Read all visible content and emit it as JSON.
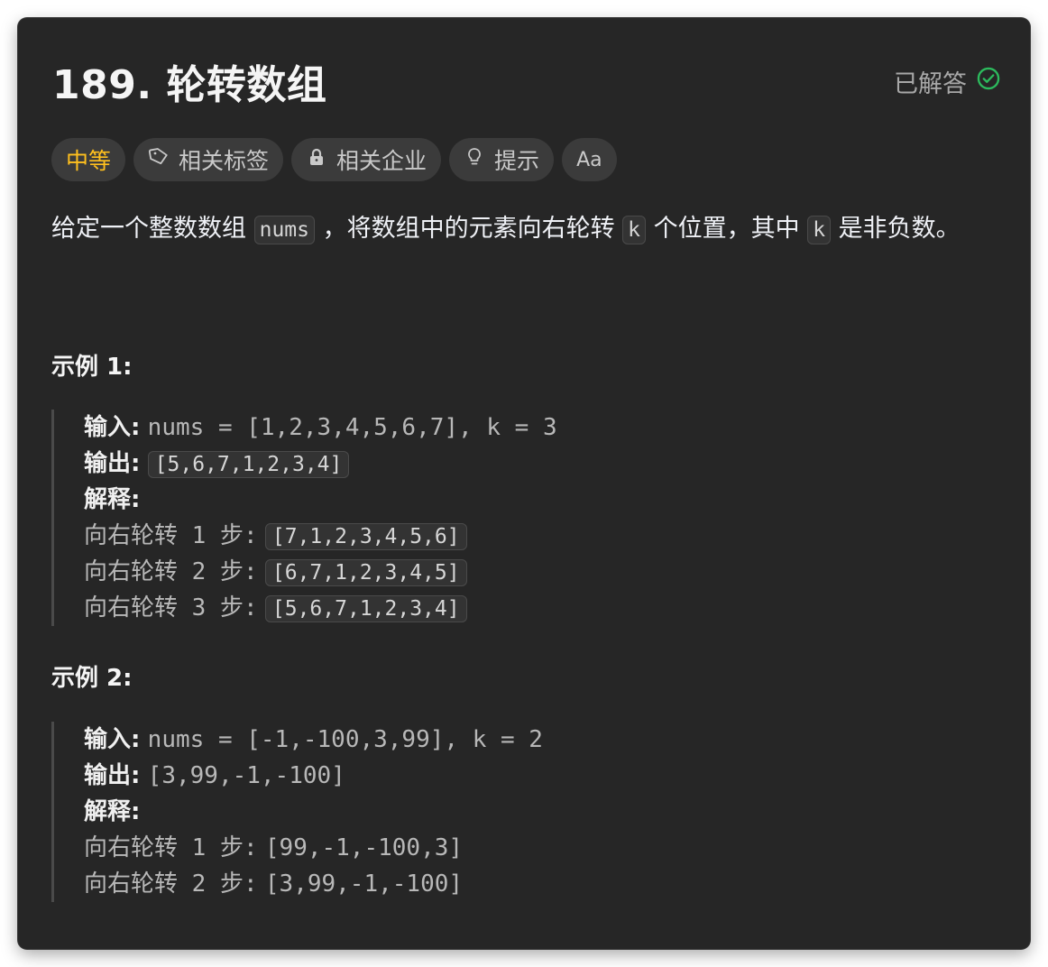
{
  "problem": {
    "title": "189. 轮转数组",
    "status_label": "已解答",
    "tags": [
      "中等",
      "相关标签",
      "相关企业",
      "提示",
      "Aa"
    ]
  },
  "description": {
    "part1": "给定一个整数数组",
    "code1": "nums",
    "part2": "，将数组中的元素向右轮转",
    "code2": "k",
    "part3": "个位置，其中",
    "code3": "k",
    "part4": "是非负数。"
  },
  "examples": [
    {
      "title": "示例 1:",
      "input_label": "输入:",
      "input": "nums = [1,2,3,4,5,6,7], k = 3",
      "output_label": "输出:",
      "output": "[5,6,7,1,2,3,4]",
      "explain_label": "解释:",
      "steps": [
        {
          "text": "向右轮转 1 步:",
          "value": "[7,1,2,3,4,5,6]"
        },
        {
          "text": "向右轮转 2 步:",
          "value": "[6,7,1,2,3,4,5]"
        },
        {
          "text": "向右轮转 3 步:",
          "value": "[5,6,7,1,2,3,4]"
        }
      ]
    },
    {
      "title": "示例 2:",
      "input_label": "输入:",
      "input": "nums = [-1,-100,3,99], k = 2",
      "output_label": "输出:",
      "output": "[3,99,-1,-100]",
      "explain_label": "解释:",
      "steps": [
        {
          "text": "向右轮转 1 步:",
          "value": "[99,-1,-100,3]"
        },
        {
          "text": "向右轮转 2 步:",
          "value": "[3,99,-1,-100]"
        }
      ]
    }
  ],
  "colors": {
    "background": "#262626",
    "difficulty": "#ffc01e",
    "solved_icon": "#2cbb5d"
  }
}
